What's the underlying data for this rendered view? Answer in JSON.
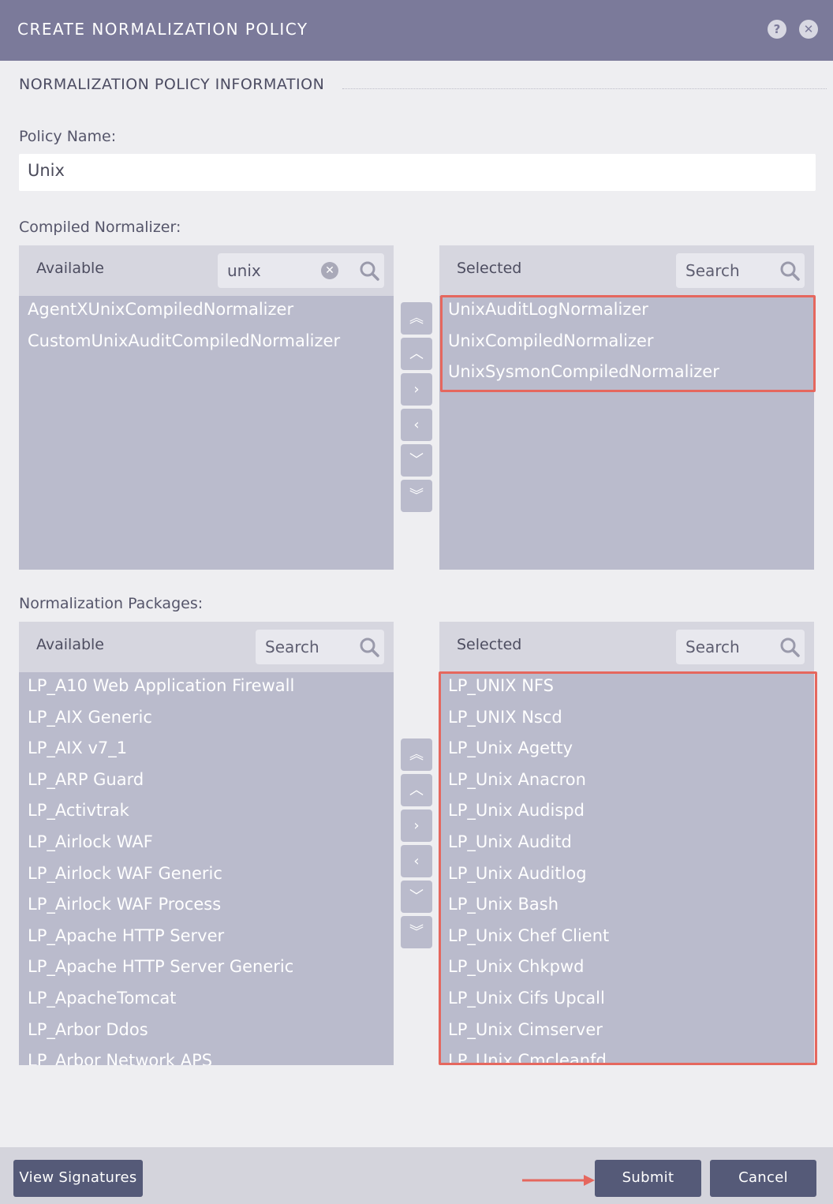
{
  "dialog": {
    "title": "CREATE NORMALIZATION POLICY",
    "help_icon": "question-circle-icon",
    "close_icon": "close-circle-icon"
  },
  "section": {
    "title": "NORMALIZATION POLICY INFORMATION"
  },
  "policy_name": {
    "label": "Policy Name:",
    "value": "Unix"
  },
  "compiled_normalizer": {
    "label": "Compiled Normalizer:",
    "available": {
      "title": "Available",
      "search_value": "unix",
      "items": [
        "AgentXUnixCompiledNormalizer",
        "CustomUnixAuditCompiledNormalizer"
      ]
    },
    "selected": {
      "title": "Selected",
      "search_placeholder": "Search",
      "items": [
        "UnixAuditLogNormalizer",
        "UnixCompiledNormalizer",
        "UnixSysmonCompiledNormalizer"
      ]
    }
  },
  "normalization_packages": {
    "label": "Normalization Packages:",
    "available": {
      "title": "Available",
      "search_placeholder": "Search",
      "items": [
        "LP_A10 Web Application Firewall",
        "LP_AIX Generic",
        "LP_AIX v7_1",
        "LP_ARP Guard",
        "LP_Activtrak",
        "LP_Airlock WAF",
        "LP_Airlock WAF Generic",
        "LP_Airlock WAF Process",
        "LP_Apache HTTP Server",
        "LP_Apache HTTP Server Generic",
        "LP_ApacheTomcat",
        "LP_Arbor Ddos",
        "LP_Arbor Network APS"
      ]
    },
    "selected": {
      "title": "Selected",
      "search_placeholder": "Search",
      "items": [
        "LP_UNIX NFS",
        "LP_UNIX Nscd",
        "LP_Unix Agetty",
        "LP_Unix Anacron",
        "LP_Unix Audispd",
        "LP_Unix Auditd",
        "LP_Unix Auditlog",
        "LP_Unix Bash",
        "LP_Unix Chef Client",
        "LP_Unix Chkpwd",
        "LP_Unix Cifs Upcall",
        "LP_Unix Cimserver",
        "LP_Unix Cmcleanfd"
      ]
    }
  },
  "move_buttons": [
    "double-chevron-up-icon",
    "chevron-up-icon",
    "chevron-right-icon",
    "chevron-left-icon",
    "chevron-down-icon",
    "double-chevron-down-icon"
  ],
  "footer": {
    "view_signatures": "View Signatures",
    "submit": "Submit",
    "cancel": "Cancel"
  },
  "colors": {
    "titlebar": "#7b7a9a",
    "list_bg": "#babbcc",
    "highlight": "#e5675e",
    "button": "#555a78"
  }
}
